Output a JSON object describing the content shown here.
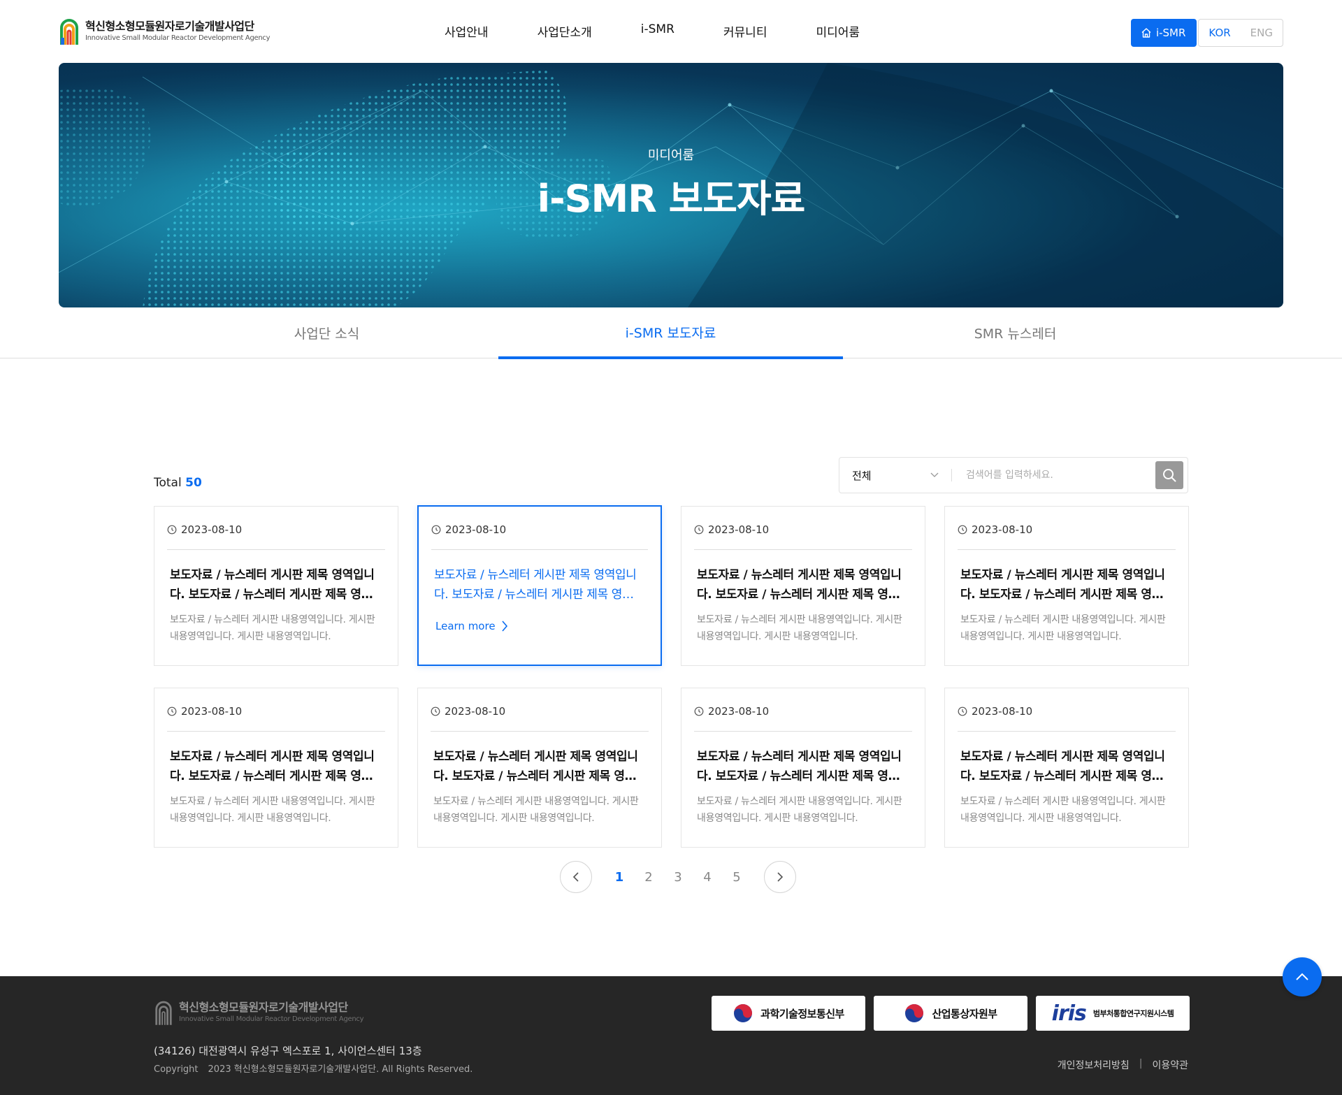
{
  "header": {
    "logo_title": "혁신형소형모듈원자로기술개발사업단",
    "logo_sub": "Innovative Small Modular Reactor Development Agency",
    "nav": [
      "사업안내",
      "사업단소개",
      "i-SMR",
      "커뮤니티",
      "미디어룸"
    ],
    "home_button": "i-SMR",
    "lang_kor": "KOR",
    "lang_eng": "ENG"
  },
  "hero": {
    "subtitle": "미디어룸",
    "title": "i-SMR 보도자료"
  },
  "tabs": [
    {
      "label": "사업단 소식",
      "active": false
    },
    {
      "label": "i-SMR 보도자료",
      "active": true
    },
    {
      "label": "SMR 뉴스레터",
      "active": false
    }
  ],
  "list": {
    "total_label": "Total",
    "total_count": "50",
    "search_select": "전체",
    "search_placeholder": "검색어를 입력하세요.",
    "learn_more": "Learn more",
    "cards": [
      {
        "date": "2023-08-10",
        "title": "보도자료 / 뉴스레터 게시판 제목 영역입니다. 보도자료 / 뉴스레터 게시판 제목 영…",
        "desc": "보도자료 / 뉴스레터 게시판 내용영역입니다. 게시판 내용영역입니다. 게시판 내용영역입니다.",
        "active": false
      },
      {
        "date": "2023-08-10",
        "title": "보도자료 / 뉴스레터 게시판 제목 영역입니다. 보도자료 / 뉴스레터 게시판 제목 영…",
        "desc": "",
        "active": true
      },
      {
        "date": "2023-08-10",
        "title": "보도자료 / 뉴스레터 게시판 제목 영역입니다. 보도자료 / 뉴스레터 게시판 제목 영…",
        "desc": "보도자료 / 뉴스레터 게시판 내용영역입니다. 게시판 내용영역입니다. 게시판 내용영역입니다.",
        "active": false
      },
      {
        "date": "2023-08-10",
        "title": "보도자료 / 뉴스레터 게시판 제목 영역입니다. 보도자료 / 뉴스레터 게시판 제목 영…",
        "desc": "보도자료 / 뉴스레터 게시판 내용영역입니다. 게시판 내용영역입니다. 게시판 내용영역입니다.",
        "active": false
      },
      {
        "date": "2023-08-10",
        "title": "보도자료 / 뉴스레터 게시판 제목 영역입니다. 보도자료 / 뉴스레터 게시판 제목 영…",
        "desc": "보도자료 / 뉴스레터 게시판 내용영역입니다. 게시판 내용영역입니다. 게시판 내용영역입니다.",
        "active": false
      },
      {
        "date": "2023-08-10",
        "title": "보도자료 / 뉴스레터 게시판 제목 영역입니다. 보도자료 / 뉴스레터 게시판 제목 영…",
        "desc": "보도자료 / 뉴스레터 게시판 내용영역입니다. 게시판 내용영역입니다. 게시판 내용영역입니다.",
        "active": false
      },
      {
        "date": "2023-08-10",
        "title": "보도자료 / 뉴스레터 게시판 제목 영역입니다. 보도자료 / 뉴스레터 게시판 제목 영…",
        "desc": "보도자료 / 뉴스레터 게시판 내용영역입니다. 게시판 내용영역입니다. 게시판 내용영역입니다.",
        "active": false
      },
      {
        "date": "2023-08-10",
        "title": "보도자료 / 뉴스레터 게시판 제목 영역입니다. 보도자료 / 뉴스레터 게시판 제목 영…",
        "desc": "보도자료 / 뉴스레터 게시판 내용영역입니다. 게시판 내용영역입니다. 게시판 내용영역입니다.",
        "active": false
      }
    ]
  },
  "pagination": {
    "pages": [
      "1",
      "2",
      "3",
      "4",
      "5"
    ],
    "current": "1"
  },
  "footer": {
    "logo_title": "혁신형소형모듈원자로기술개발사업단",
    "logo_sub": "Innovative Small Modular Reactor Development Agency",
    "address": "(34126) 대전광역시 유성구 엑스포로 1, 사이언스센터 13층",
    "copyright_label": "Copyright",
    "copyright_text": "2023 혁신형소형모듈원자로기술개발사업단. All Rights Reserved.",
    "banner_msit": "과학기술정보통신부",
    "banner_motie": "산업통상자원부",
    "banner_iris_logo": "iris",
    "banner_iris_text": "범부처통합연구지원시스템",
    "link_privacy": "개인정보처리방침",
    "link_terms": "이용약관",
    "link_sep": "|"
  },
  "colors": {
    "accent": "#0a6cf0",
    "footer_bg": "#262626",
    "hero_bg": "#08385a"
  }
}
